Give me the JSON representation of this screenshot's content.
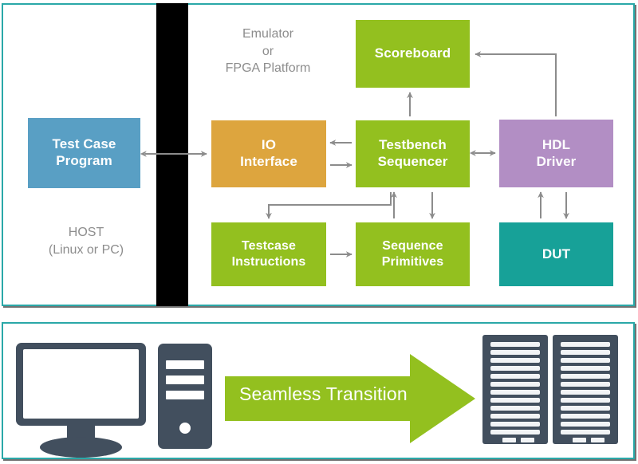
{
  "diagram": {
    "title": "Emulation / FPGA verification environment with seamless transition",
    "top_panel": {
      "host_side": {
        "platform_label": "HOST\n(Linux or PC)",
        "platform_label_line1": "HOST",
        "platform_label_line2": "(Linux or PC)",
        "boxes": [
          {
            "id": "test-case-program",
            "label": "Test Case Program",
            "label_line1": "Test Case",
            "label_line2": "Program",
            "color": "#599fc4"
          }
        ]
      },
      "emulator_side": {
        "platform_label_line1": "Emulator",
        "platform_label_line2": "or",
        "platform_label_line3": "FPGA Platform",
        "boxes": [
          {
            "id": "io-interface",
            "label": "IO Interface",
            "label_line1": "IO",
            "label_line2": "Interface",
            "color": "#dda53e"
          },
          {
            "id": "scoreboard",
            "label": "Scoreboard",
            "label_line1": "Scoreboard",
            "label_line2": "",
            "color": "#93c01f"
          },
          {
            "id": "testbench-sequencer",
            "label": "Testbench Sequencer",
            "label_line1": "Testbench",
            "label_line2": "Sequencer",
            "color": "#93c01f"
          },
          {
            "id": "testcase-instructions",
            "label": "Testcase Instructions",
            "label_line1": "Testcase",
            "label_line2": "Instructions",
            "color": "#93c01f"
          },
          {
            "id": "sequence-primitives",
            "label": "Sequence Primitives",
            "label_line1": "Sequence",
            "label_line2": "Primitives",
            "color": "#93c01f"
          },
          {
            "id": "hdl-driver",
            "label": "HDL Driver",
            "label_line1": "HDL",
            "label_line2": "Driver",
            "color": "#b28ec4"
          },
          {
            "id": "dut",
            "label": "DUT",
            "label_line1": "DUT",
            "label_line2": "",
            "color": "#17a198"
          }
        ]
      },
      "connections": [
        {
          "from": "test-case-program",
          "to": "io-interface",
          "type": "bidirectional"
        },
        {
          "from": "io-interface",
          "to": "testbench-sequencer",
          "type": "bidirectional"
        },
        {
          "from": "testbench-sequencer",
          "to": "scoreboard",
          "type": "directed-up"
        },
        {
          "from": "testbench-sequencer",
          "to": "hdl-driver",
          "type": "bidirectional"
        },
        {
          "from": "hdl-driver",
          "to": "scoreboard",
          "type": "elbow-up-left"
        },
        {
          "from": "hdl-driver",
          "to": "dut",
          "type": "bidirectional-vertical"
        },
        {
          "from": "testbench-sequencer",
          "to": "testcase-instructions",
          "type": "elbow-down-left"
        },
        {
          "from": "testcase-instructions",
          "to": "sequence-primitives",
          "type": "directed-right"
        },
        {
          "from": "testbench-sequencer",
          "to": "sequence-primitives",
          "type": "bidirectional-vertical"
        }
      ]
    },
    "bottom_panel": {
      "arrow_label": "Seamless Transition",
      "left_icon": "desktop-computer-icon",
      "right_icon": "server-rack-icon",
      "arrow_icon": "right-arrow-icon",
      "rack_count": 2,
      "rack_slots_per_rack": 12
    },
    "colors": {
      "panel_border": "#2aa8a8",
      "divider": "#000000",
      "green": "#93c01f",
      "blue": "#599fc4",
      "orange": "#dda53e",
      "purple": "#b28ec4",
      "teal": "#17a198",
      "slate": "#424f5e",
      "label_gray": "#8d8d8d",
      "wire_gray": "#8c8c8c"
    }
  }
}
